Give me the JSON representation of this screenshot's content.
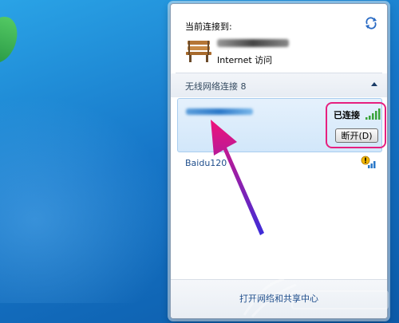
{
  "flyout": {
    "current_connected_to_label": "当前连接到:",
    "internet_access_label": "Internet 访问",
    "wireless_section_label": "无线网络连接 8",
    "connected_network": {
      "status": "已连接",
      "disconnect_label": "断开(D)"
    },
    "networks": [
      {
        "name": "Baidu120"
      }
    ],
    "open_center_label": "打开网络和共享中心"
  },
  "colors": {
    "highlight": "#e6207f",
    "link": "#1f4e8c",
    "selected_bg": "#d2e7fa"
  },
  "icons": {
    "refresh": "refresh-icon",
    "network": "bench-icon",
    "signal": "signal-bars-icon",
    "open_network": "open-network-warning-icon"
  }
}
